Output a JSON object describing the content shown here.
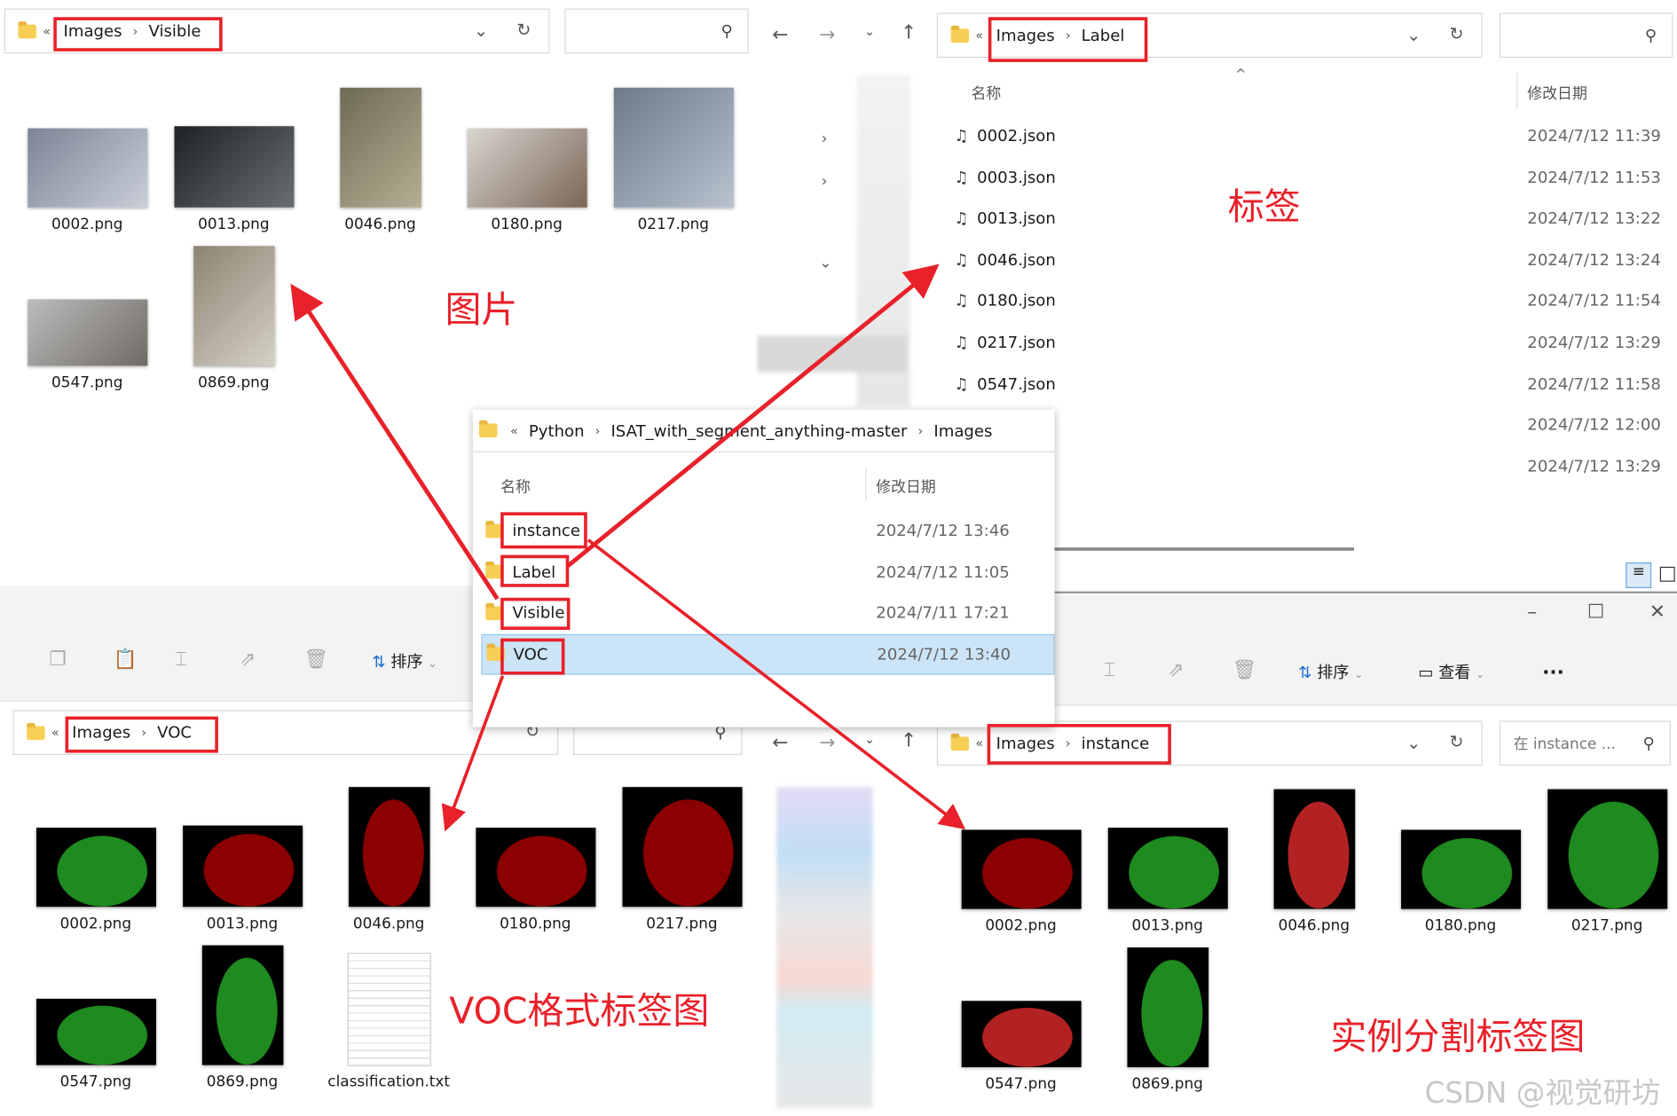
{
  "visible_window": {
    "breadcrumb": [
      "Images",
      "Visible"
    ],
    "items": [
      {
        "name": "0002.png",
        "kind": "photo",
        "w": 112,
        "h": 74,
        "c1": "#7c8596",
        "c2": "#c9ced8"
      },
      {
        "name": "0013.png",
        "kind": "photo",
        "w": 112,
        "h": 76,
        "c1": "#1f2224",
        "c2": "#6a6e72"
      },
      {
        "name": "0046.png",
        "kind": "photo",
        "w": 76,
        "h": 112,
        "c1": "#6d6a55",
        "c2": "#b6ae93"
      },
      {
        "name": "0180.png",
        "kind": "photo",
        "w": 112,
        "h": 74,
        "c1": "#d9d6d0",
        "c2": "#7a6556"
      },
      {
        "name": "0217.png",
        "kind": "photo",
        "w": 112,
        "h": 112,
        "c1": "#6d7a8c",
        "c2": "#b8c2cf"
      },
      {
        "name": "0547.png",
        "kind": "photo",
        "w": 112,
        "h": 62,
        "c1": "#bcbcbc",
        "c2": "#6f6a64"
      },
      {
        "name": "0869.png",
        "kind": "photo",
        "w": 76,
        "h": 112,
        "c1": "#8d8372",
        "c2": "#d5d1c6"
      }
    ]
  },
  "label_window": {
    "breadcrumb": [
      "Images",
      "Label"
    ],
    "col_name": "名称",
    "col_date": "修改日期",
    "files": [
      "0002.json",
      "0003.json",
      "0013.json",
      "0046.json",
      "0180.json",
      "0217.json",
      "0547.json"
    ],
    "dates": [
      "2024/7/12 11:39",
      "2024/7/12 11:53",
      "2024/7/12 13:22",
      "2024/7/12 13:24",
      "2024/7/12 11:54",
      "2024/7/12 13:29",
      "2024/7/12 11:58",
      "2024/7/12 12:00",
      "2024/7/12 13:29"
    ]
  },
  "voc_window": {
    "breadcrumb": [
      "Images",
      "VOC"
    ],
    "sort_label": "排序",
    "items": [
      {
        "name": "0002.png",
        "kind": "mask",
        "w": 112,
        "h": 74,
        "fg": "#1f8a1f"
      },
      {
        "name": "0013.png",
        "kind": "mask",
        "w": 112,
        "h": 76,
        "fg": "#8b0000"
      },
      {
        "name": "0046.png",
        "kind": "mask",
        "w": 76,
        "h": 112,
        "fg": "#8b0000"
      },
      {
        "name": "0180.png",
        "kind": "mask",
        "w": 112,
        "h": 74,
        "fg": "#8b0000"
      },
      {
        "name": "0217.png",
        "kind": "mask",
        "w": 112,
        "h": 112,
        "fg": "#8b0000"
      },
      {
        "name": "0547.png",
        "kind": "mask",
        "w": 112,
        "h": 62,
        "fg": "#1f8a1f"
      },
      {
        "name": "0869.png",
        "kind": "mask",
        "w": 76,
        "h": 112,
        "fg": "#1f8a1f"
      },
      {
        "name": "classification.txt",
        "kind": "doc",
        "w": 76,
        "h": 104
      }
    ]
  },
  "instance_window": {
    "breadcrumb": [
      "Images",
      "instance"
    ],
    "search_placeholder": "在 instance ...",
    "sort_label": "排序",
    "view_label": "查看",
    "more_label": "...",
    "items": [
      {
        "name": "0002.png",
        "kind": "mask",
        "w": 112,
        "h": 74,
        "fg": "#8b0000"
      },
      {
        "name": "0013.png",
        "kind": "mask",
        "w": 112,
        "h": 76,
        "fg": "#1f8a1f"
      },
      {
        "name": "0046.png",
        "kind": "mask",
        "w": 76,
        "h": 112,
        "fg": "#b22222"
      },
      {
        "name": "0180.png",
        "kind": "mask",
        "w": 112,
        "h": 74,
        "fg": "#1f8a1f"
      },
      {
        "name": "0217.png",
        "kind": "mask",
        "w": 112,
        "h": 112,
        "fg": "#1f8a1f"
      },
      {
        "name": "0547.png",
        "kind": "mask",
        "w": 112,
        "h": 62,
        "fg": "#b22222"
      },
      {
        "name": "0869.png",
        "kind": "mask",
        "w": 76,
        "h": 112,
        "fg": "#1f8a1f"
      }
    ]
  },
  "popup": {
    "breadcrumb": [
      "Python",
      "ISAT_with_segment_anything-master",
      "Images"
    ],
    "col_name": "名称",
    "col_date": "修改日期",
    "rows": [
      {
        "name": "instance",
        "date": "2024/7/12 13:46"
      },
      {
        "name": "Label",
        "date": "2024/7/12 11:05"
      },
      {
        "name": "Visible",
        "date": "2024/7/11 17:21"
      },
      {
        "name": "VOC",
        "date": "2024/7/12 13:40",
        "selected": true
      }
    ]
  },
  "annotations": {
    "images": "图片",
    "labels": "标签",
    "voc": "VOC格式标签图",
    "instance": "实例分割标签图",
    "color": "#e8212a"
  },
  "watermark": "CSDN @视觉研坊"
}
